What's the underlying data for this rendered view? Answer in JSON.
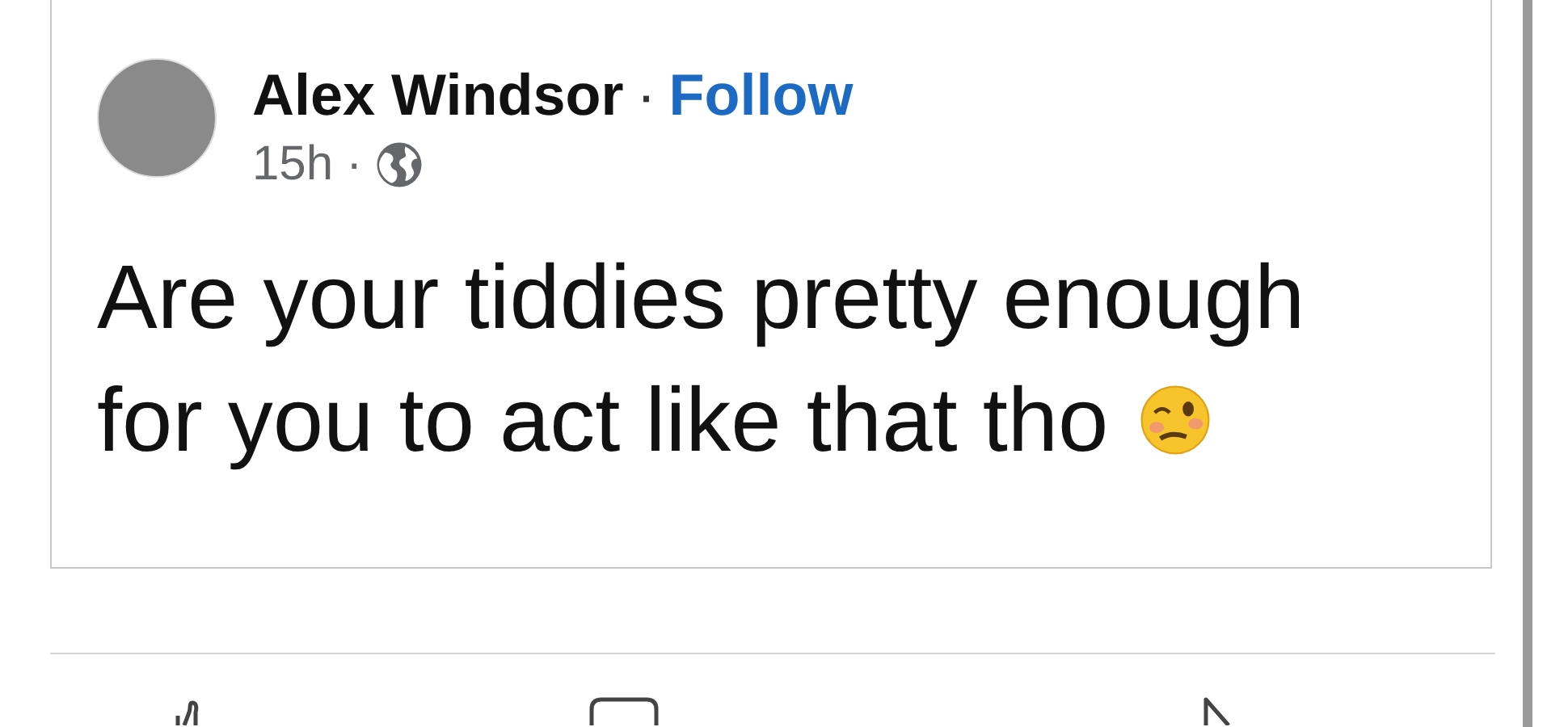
{
  "post": {
    "author": "Alex Windsor",
    "separator": "·",
    "follow": "Follow",
    "time": "15h",
    "time_separator": "·",
    "text_lines": [
      "Are your tiddies pretty enough",
      "for you to act like that tho"
    ]
  },
  "actions": [
    {
      "kind": "like"
    },
    {
      "kind": "comment"
    },
    {
      "kind": "share"
    }
  ]
}
